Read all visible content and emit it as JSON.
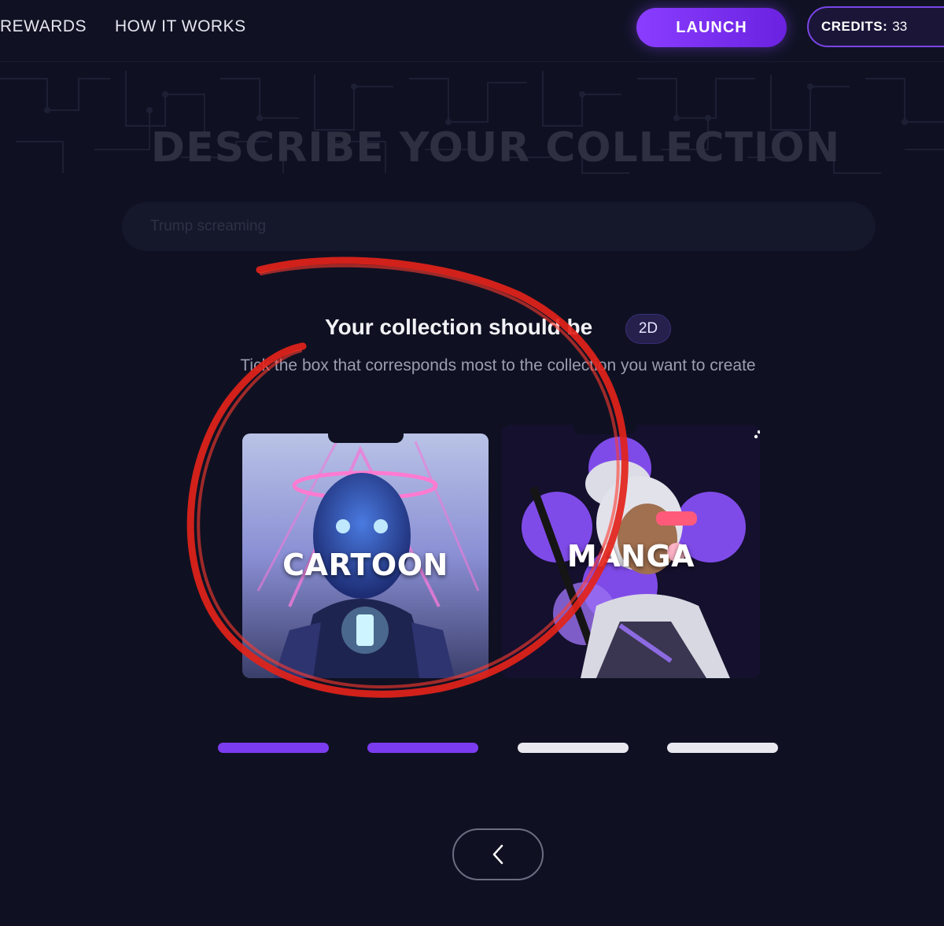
{
  "nav": {
    "rewards_label": "REWARDS",
    "how_it_works_label": "HOW IT WORKS",
    "launch_label": "LAUNCH",
    "credits_label": "CREDITS:",
    "credits_value": "33"
  },
  "main": {
    "title": "DESCRIBE YOUR COLLECTION",
    "search_placeholder": "Trump screaming",
    "heading": "Your collection should be",
    "dimension_badge": "2D",
    "subtext": "Tick the box that corresponds most to the collection you want to create",
    "options": [
      {
        "label": "CARTOON"
      },
      {
        "label": "MANGA"
      }
    ]
  },
  "progress": {
    "steps_total": 4,
    "steps_completed": 2,
    "active_color": "#7b3cf0",
    "inactive_color": "#e8e8ee"
  },
  "icons": {
    "back": "chevron-left-icon",
    "corner": "triangle-dots-icon"
  },
  "colors": {
    "background": "#0f1122",
    "accent": "#8a3dff",
    "annotation": "#e2231a"
  }
}
